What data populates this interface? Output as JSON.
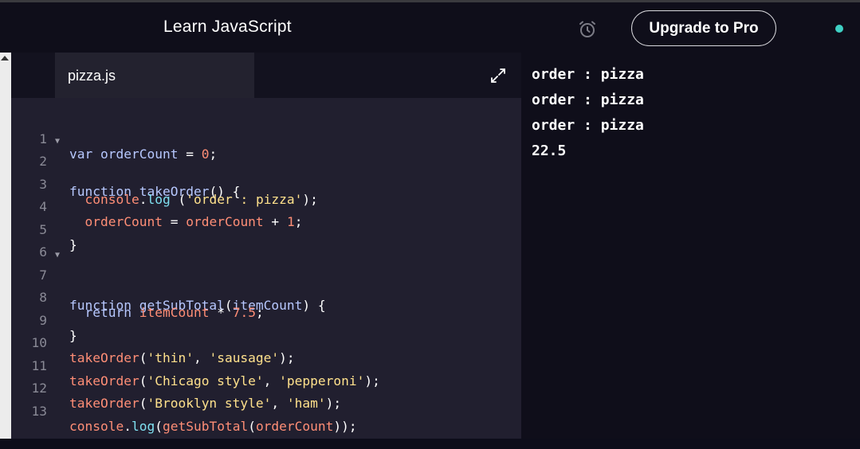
{
  "header": {
    "title": "Learn JavaScript",
    "alarm_icon": "alarm-clock-icon",
    "upgrade_label": "Upgrade to Pro",
    "status_color": "#3fd0c4"
  },
  "editor": {
    "tab_label": "pizza.js",
    "expand_icon": "expand-icon",
    "lines": [
      {
        "n": "1"
      },
      {
        "n": "2"
      },
      {
        "n": "3"
      },
      {
        "n": "4"
      },
      {
        "n": "5"
      },
      {
        "n": "6"
      },
      {
        "n": "7"
      },
      {
        "n": "8"
      },
      {
        "n": "9"
      },
      {
        "n": "10"
      },
      {
        "n": "11"
      },
      {
        "n": "12"
      },
      {
        "n": "13"
      }
    ],
    "tokens": {
      "var": "var",
      "orderCount": "orderCount",
      "eq": " = ",
      "zero": "0",
      "semi": ";",
      "function": "function",
      "takeOrder": "takeOrder",
      "parens_open_brace": "() {",
      "console": "console",
      "dot": ".",
      "log": "log",
      "space_paren": " (",
      "order_pizza": "'order : pizza'",
      "close_semi": ");",
      "plus": " + ",
      "one": "1",
      "close_brace": "}",
      "getSubTotal": "getSubTotal",
      "lparen": "(",
      "itemCount": "itemCount",
      "rparen_brace": ") {",
      "return": "return",
      "times": " * ",
      "seven_five": "7.5",
      "thin": "'thin'",
      "comma": ", ",
      "sausage": "'sausage'",
      "chicago": "'Chicago style'",
      "pepperoni": "'pepperoni'",
      "brooklyn": "'Brooklyn style'",
      "ham": "'ham'",
      "double_close_semi": "));"
    }
  },
  "console": {
    "output": [
      "order : pizza",
      "order : pizza",
      "order : pizza",
      "22.5"
    ]
  }
}
